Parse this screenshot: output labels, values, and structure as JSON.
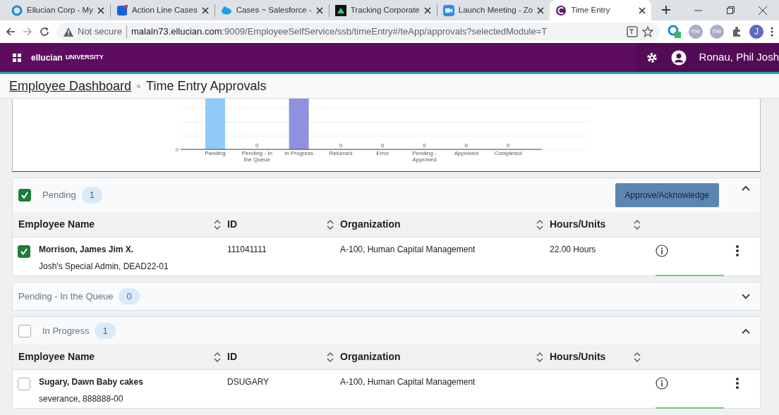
{
  "browser": {
    "tabs": [
      {
        "title": "Ellucian Corp - My",
        "selected": false
      },
      {
        "title": "Action Line Cases",
        "selected": false
      },
      {
        "title": "Cases ~ Salesforce -",
        "selected": false
      },
      {
        "title": "Tracking Corporate",
        "selected": false
      },
      {
        "title": "Launch Meeting - Zo",
        "selected": false
      },
      {
        "title": "Time Entry",
        "selected": true
      }
    ],
    "security": "Not secure",
    "url_host": "malaln73.ellucian.com",
    "url_rest": ":9009/EmployeeSelfService/ssb/timeEntry#/teApp/approvals?selectedModule=T",
    "extensions": [
      {
        "label": "me"
      },
      {
        "label": "me"
      }
    ],
    "profile": "J"
  },
  "app_header": {
    "brand": "ellucian",
    "brand_suffix": "UNIVERSITY",
    "user": "Ronau, Phil Josh"
  },
  "breadcrumb": [
    {
      "label": "Employee Dashboard",
      "link": true
    },
    {
      "label": "Time Entry Approvals",
      "link": false
    }
  ],
  "chart": {
    "axis_label": "0",
    "categories": [
      {
        "label": "Pending",
        "color": "#90caf9"
      },
      {
        "label": "Pending - In the Queue",
        "value_label": "0"
      },
      {
        "label": "In Progress",
        "color": "#9090e0"
      },
      {
        "label": "Returned",
        "value_label": "0"
      },
      {
        "label": "Error",
        "value_label": "0"
      },
      {
        "label": "Pending - Approved",
        "value_label": "0"
      },
      {
        "label": "Approved",
        "value_label": "0"
      },
      {
        "label": "Completed",
        "value_label": "0"
      }
    ]
  },
  "sections": [
    {
      "label": "Pending",
      "count": "1",
      "kind": "checkable",
      "checked": true,
      "expanded": true,
      "action": "Approve/Acknowledge",
      "columns": [
        "Employee Name",
        "ID",
        "Organization",
        "Hours/Units"
      ],
      "rows": [
        {
          "name": "Morrison, James Jim X.",
          "detail": "Josh's Special Admin, DEAD22-01",
          "id": "111041111",
          "organization": "A-100, Human Capital Management",
          "hours": "22.00 Hours",
          "selected": true
        }
      ]
    },
    {
      "label": "Pending - In the Queue",
      "count": "0",
      "kind": "plain",
      "expanded": false
    },
    {
      "label": "In Progress",
      "count": "1",
      "kind": "checkable",
      "checked": false,
      "expanded": true,
      "columns": [
        "Employee Name",
        "ID",
        "Organization",
        "Hours/Units"
      ],
      "rows": [
        {
          "name": "Sugary, Dawn Baby cakes",
          "detail": "severance, 888888-00",
          "id": "DSUGARY",
          "organization": "A-100, Human Capital Management",
          "selected": false
        }
      ]
    }
  ]
}
